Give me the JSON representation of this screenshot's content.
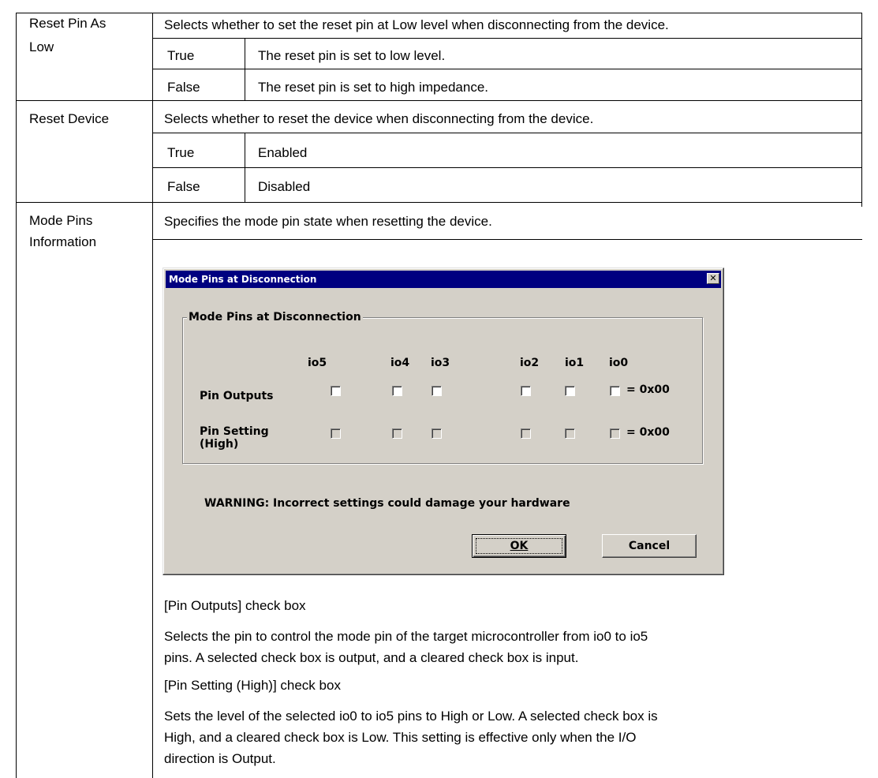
{
  "rows": [
    {
      "label_lines": [
        "Reset Pin As",
        "Low"
      ],
      "description": "Selects whether to set the reset pin at Low level when disconnecting from the device.",
      "options": [
        {
          "value": "True",
          "text": "The reset pin is set to low level."
        },
        {
          "value": "False",
          "text": "The reset pin is set to high impedance."
        }
      ]
    },
    {
      "label_lines": [
        "Reset Device"
      ],
      "description": "Selects whether to reset the device when disconnecting from the device.",
      "options": [
        {
          "value": "True",
          "text": "Enabled"
        },
        {
          "value": "False",
          "text": "Disabled"
        }
      ]
    },
    {
      "label_lines": [
        "Mode Pins",
        "Information"
      ],
      "description": "Specifies the mode pin state when resetting the device.",
      "notes": [
        "[Pin Outputs] check box",
        "Selects the pin to control the mode pin of the target microcontroller from io0 to io5",
        "pins.  A selected check box is output, and a cleared check box is input.",
        "[Pin Setting (High)] check box",
        "Sets the level of the selected io0 to io5 pins to High or Low.  A selected check box is",
        "High, and a cleared check box is Low.  This setting is effective only when the I/O",
        "direction is Output."
      ]
    }
  ],
  "dialog": {
    "title": "Mode Pins at Disconnection",
    "close_glyph": "✕",
    "group_label": "Mode Pins at Disconnection",
    "pins": [
      "io5",
      "io4",
      "io3",
      "io2",
      "io1",
      "io0"
    ],
    "pin_outputs_label": "Pin Outputs",
    "pin_setting_label_lines": [
      "Pin Setting",
      "(High)"
    ],
    "pin_outputs_value": "= 0x00",
    "pin_setting_value": "= 0x00",
    "pin_outputs_checked": [
      false,
      false,
      false,
      false,
      false,
      false
    ],
    "pin_setting_checked": [
      false,
      false,
      false,
      false,
      false,
      false
    ],
    "pin_setting_enabled": false,
    "warning": "WARNING: Incorrect settings could damage your hardware",
    "ok_label": "OK",
    "cancel_label": "Cancel",
    "titlebar_color": "#000080",
    "face_color": "#d4d0c8"
  }
}
